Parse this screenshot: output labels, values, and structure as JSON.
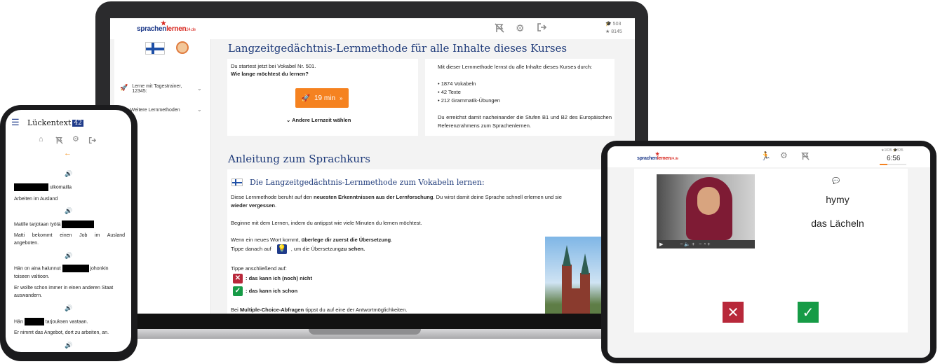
{
  "brand": {
    "name_part1": "sprachen",
    "name_part2": "lernen",
    "name_part3": "24.de"
  },
  "colors": {
    "brand_blue": "#1f3b8a",
    "brand_red": "#d7261e",
    "orange": "#f58220",
    "deny_red": "#b8283a",
    "ok_green": "#169b46",
    "title_blue": "#1f3b7a"
  },
  "laptop": {
    "topbar": {
      "icons": [
        "flag-off-icon",
        "gear-icon",
        "logout-icon"
      ],
      "stat_1": "503",
      "stat_2": "8145"
    },
    "sidebar": {
      "items": [
        {
          "icon": "rocket-icon",
          "label_line1": "Lerne mit Tagestrainer,",
          "label_line2": "12345:"
        },
        {
          "icon": "book-icon",
          "label_line1": "Weitere Lernmethoden",
          "label_line2": ""
        }
      ]
    },
    "main": {
      "title": "Langzeitgedächtnis-Lernmethode für alle Inhalte dieses Kurses",
      "left_card": {
        "start_text": "Du startest jetzt bei Vokabel Nr. 501.",
        "question": "Wie lange möchtest du lernen?",
        "button_label": "19 min",
        "button_arrow": "»",
        "other_time": "Andere Lernzeit wählen"
      },
      "right_card": {
        "intro": "Mit dieser Lernmethode lernst du alle Inhalte dieses Kurses durch:",
        "bullets": [
          "1874 Vokabeln",
          "42 Texte",
          "212 Grammatik-Übungen"
        ],
        "outro": "Du erreichst damit nacheinander die Stufen B1 und B2 des Europäischen Referenzrahmens zum Sprachenlernen."
      },
      "section_title": "Anleitung zum Sprachkurs",
      "guide": {
        "heading": "Die Langzeitgedächtnis-Lernmethode zum Vokabeln lernen:",
        "p1_a": "Diese Lernmethode beruht auf den ",
        "p1_b": "neuesten Erkenntnissen aus der Lernforschung",
        "p1_c": ". Du wirst damit deine Sprache schnell erlernen und sie",
        "p1_d": "wieder vergessen",
        "p1_e": ".",
        "p2": "Beginne mit dem Lernen, indem du antippst wie viele Minuten du lernen möchtest.",
        "p3_a": "Wenn ein neues Wort kommt, ",
        "p3_b": "überlege dir zuerst die Übersetzung",
        "p3_c": ".",
        "p4_a": "Tippe danach auf",
        "p4_b": ", um die Übersetzung ",
        "p4_c": "zu sehen.",
        "p5": "Tippe anschließend auf:",
        "opt_no": ": das kann ich (noch) nicht",
        "opt_yes": ": das kann ich schon",
        "p6_a": "Bei ",
        "p6_b": "Multiple-Choice-Abfragen",
        "p6_c": " tippst du auf eine der Antwortmöglichkeiten."
      }
    }
  },
  "phone": {
    "title": "Lückentext",
    "badge": "42",
    "icons": [
      "home-icon",
      "flag-off-icon",
      "gear-icon",
      "logout-icon"
    ],
    "back_arrow": "←",
    "items": [
      {
        "before": "",
        "after": " ulkomailla",
        "translation": "Arbeiten im Ausland"
      },
      {
        "before": "Matille tarjotaan työtä ",
        "after": "",
        "translation_1": "Matti bekommt einen Job im Ausland",
        "translation_2": "angeboten."
      },
      {
        "before": "Hän on aina halunnut ",
        "after": " johonkin",
        "line2": "toiseen valtioon.",
        "translation_1": "Er wollte schon immer in einen anderen Staat",
        "translation_2": "auswandern."
      },
      {
        "before": "Hän ",
        "after": " tarjouksen vastaan.",
        "translation": "Er nimmt das Angebot, dort zu arbeiten, an."
      }
    ]
  },
  "tablet": {
    "icons": [
      "exit-run-icon",
      "gear-icon",
      "flag-off-icon"
    ],
    "stat_1": "1035",
    "stat_2": "535",
    "timer": "6:56",
    "word": "hymy",
    "translation": "das Lächeln",
    "no_symbol": "✕",
    "yes_symbol": "✓"
  }
}
